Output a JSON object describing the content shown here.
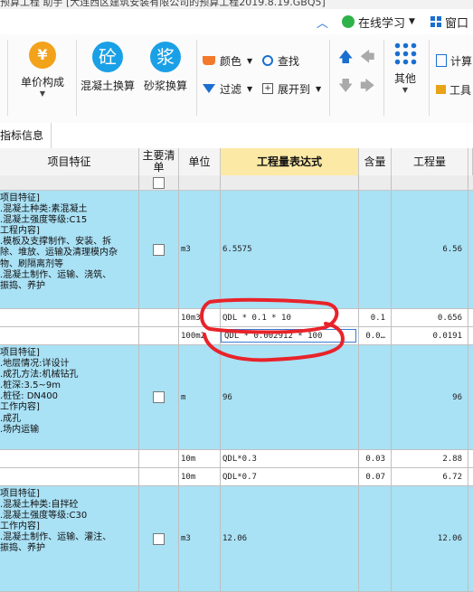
{
  "title_bar": {
    "text": "预算工程  助手 [大连西区建筑安装有限公司的预算工程2019.8.19.GBQ5]"
  },
  "topbar": {
    "online_learning": "在线学习",
    "window": "窗口"
  },
  "ribbon": {
    "unit_price": "单价构成",
    "concrete": "混凝土换算",
    "concrete_glyph": "砼",
    "mortar": "砂浆换算",
    "mortar_glyph": "浆",
    "color": "颜色",
    "find": "查找",
    "filter": "过滤",
    "expand": "展开到",
    "other": "其他",
    "calculator": "计算",
    "tools": "工具"
  },
  "tabs": {
    "active": "指标信息"
  },
  "table": {
    "headers": {
      "feature": "项目特征",
      "main": "主要清单",
      "unit": "单位",
      "expr": "工程量表达式",
      "content": "含量",
      "qty": "工程量"
    },
    "rows": [
      {
        "feature": "项目特征]\n.混凝土种类:素混凝土\n.混凝土强度等级:C15\n工程内容]\n.模板及支撑制作、安装、拆\n除、堆放、运输及清理模内杂\n物、刷隔离剂等\n.混凝土制作、运输、浇筑、\n振捣、养护",
        "unit": "m3",
        "expr": "6.5575",
        "content": "",
        "qty": "6.56"
      },
      {
        "feature": "",
        "unit": "10m3",
        "expr": "QDL * 0.1 * 10",
        "content": "0.1",
        "qty": "0.656"
      },
      {
        "feature": "",
        "unit": "100m2",
        "expr": "QDL * 0.002912 * 100",
        "content": "0.0…",
        "qty": "0.0191"
      },
      {
        "feature": "项目特征]\n.地层情况:详设计\n.成孔方法:机械钻孔\n.桩深:3.5~9m\n.桩径: DN400\n工作内容]\n.成孔\n.场内运输",
        "unit": "m",
        "expr": "96",
        "content": "",
        "qty": "96"
      },
      {
        "feature": "",
        "unit": "10m",
        "expr": "QDL*0.3",
        "content": "0.03",
        "qty": "2.88"
      },
      {
        "feature": "",
        "unit": "10m",
        "expr": "QDL*0.7",
        "content": "0.07",
        "qty": "6.72"
      },
      {
        "feature": "项目特征]\n.混凝土种类:自拌砼\n.混凝土强度等级:C30\n工作内容]\n.混凝土制作、运输、灌注、\n振捣、养护",
        "unit": "m3",
        "expr": "12.06",
        "content": "",
        "qty": "12.06"
      }
    ]
  },
  "colors": {
    "row_blue": "#a9e1f5",
    "header_active": "#fde9a6",
    "annotation_red": "#e8232a",
    "accent": "#1aa0e6"
  }
}
